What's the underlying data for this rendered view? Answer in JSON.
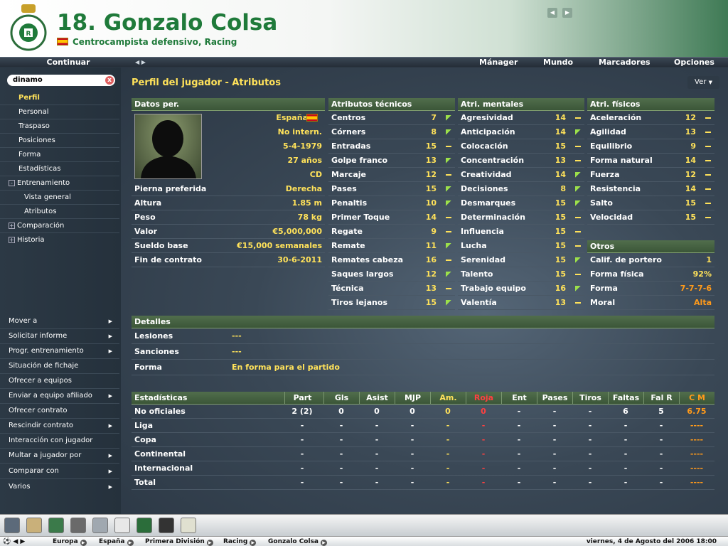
{
  "header": {
    "title": "18. Gonzalo Colsa",
    "subtitle": "Centrocampista defensivo, Racing",
    "club_crest_text": "REAL RACING CLUB SANTANDER"
  },
  "menubar": {
    "continue_label": "Continuar",
    "items": [
      "Mánager",
      "Mundo",
      "Marcadores",
      "Opciones"
    ]
  },
  "sidebar": {
    "search_value": "dinamo",
    "search_clear": "x",
    "items": [
      {
        "label": "Perfil"
      },
      {
        "label": "Personal"
      },
      {
        "label": "Traspaso"
      },
      {
        "label": "Posiciones"
      },
      {
        "label": "Forma"
      },
      {
        "label": "Estadísticas"
      },
      {
        "label": "Entrenamiento"
      },
      {
        "label": "Vista general"
      },
      {
        "label": "Atributos"
      },
      {
        "label": "Comparación"
      },
      {
        "label": "Historia"
      }
    ],
    "actions": [
      "Mover a",
      "Solicitar informe",
      "Progr. entrenamiento",
      "Situación de fichaje",
      "Ofrecer a equipos",
      "Enviar a equipo afiliado",
      "Ofrecer contrato",
      "Rescindir contrato",
      "Interacción con jugador",
      "Multar a jugador por",
      "Comparar con",
      "Varios"
    ]
  },
  "panel": {
    "title": "Perfil del jugador - Atributos",
    "ver_label": "Ver"
  },
  "personal": {
    "header": "Datos per.",
    "nationality": "España",
    "intl": "No intern.",
    "dob": "5-4-1979",
    "age": "27 años",
    "position": "CD",
    "rows": [
      {
        "label": "Pierna preferida",
        "value": "Derecha"
      },
      {
        "label": "Altura",
        "value": "1.85 m"
      },
      {
        "label": "Peso",
        "value": "78 kg"
      },
      {
        "label": "Valor",
        "value": "€5,000,000"
      },
      {
        "label": "Sueldo base",
        "value": "€15,000 semanales"
      },
      {
        "label": "Fin de contrato",
        "value": "30-6-2011"
      }
    ]
  },
  "technical": {
    "header": "Atributos técnicos",
    "rows": [
      {
        "label": "Centros",
        "value": "7",
        "trend": "up"
      },
      {
        "label": "Córners",
        "value": "8",
        "trend": "up"
      },
      {
        "label": "Entradas",
        "value": "15",
        "trend": "eq"
      },
      {
        "label": "Golpe franco",
        "value": "13",
        "trend": "up"
      },
      {
        "label": "Marcaje",
        "value": "12",
        "trend": "eq"
      },
      {
        "label": "Pases",
        "value": "15",
        "trend": "up"
      },
      {
        "label": "Penaltis",
        "value": "10",
        "trend": "up"
      },
      {
        "label": "Primer Toque",
        "value": "14",
        "trend": "eq"
      },
      {
        "label": "Regate",
        "value": "9",
        "trend": "eq"
      },
      {
        "label": "Remate",
        "value": "11",
        "trend": "up"
      },
      {
        "label": "Remates cabeza",
        "value": "16",
        "trend": "eq"
      },
      {
        "label": "Saques largos",
        "value": "12",
        "trend": "up"
      },
      {
        "label": "Técnica",
        "value": "13",
        "trend": "eq"
      },
      {
        "label": "Tiros lejanos",
        "value": "15",
        "trend": "up"
      }
    ]
  },
  "mental": {
    "header": "Atri. mentales",
    "rows": [
      {
        "label": "Agresividad",
        "value": "14",
        "trend": "eq"
      },
      {
        "label": "Anticipación",
        "value": "14",
        "trend": "up"
      },
      {
        "label": "Colocación",
        "value": "15",
        "trend": "eq"
      },
      {
        "label": "Concentración",
        "value": "13",
        "trend": "eq"
      },
      {
        "label": "Creatividad",
        "value": "14",
        "trend": "up"
      },
      {
        "label": "Decisiones",
        "value": "8",
        "trend": "up"
      },
      {
        "label": "Desmarques",
        "value": "15",
        "trend": "up"
      },
      {
        "label": "Determinación",
        "value": "15",
        "trend": "eq"
      },
      {
        "label": "Influencia",
        "value": "15",
        "trend": "eq"
      },
      {
        "label": "Lucha",
        "value": "15",
        "trend": "eq"
      },
      {
        "label": "Serenidad",
        "value": "15",
        "trend": "up"
      },
      {
        "label": "Talento",
        "value": "15",
        "trend": "eq"
      },
      {
        "label": "Trabajo equipo",
        "value": "16",
        "trend": "up"
      },
      {
        "label": "Valentía",
        "value": "13",
        "trend": "eq"
      }
    ]
  },
  "physical": {
    "header": "Atri. físicos",
    "rows": [
      {
        "label": "Aceleración",
        "value": "12",
        "trend": "eq"
      },
      {
        "label": "Agilidad",
        "value": "13",
        "trend": "eq"
      },
      {
        "label": "Equilibrio",
        "value": "9",
        "trend": "eq"
      },
      {
        "label": "Forma natural",
        "value": "14",
        "trend": "eq"
      },
      {
        "label": "Fuerza",
        "value": "12",
        "trend": "eq"
      },
      {
        "label": "Resistencia",
        "value": "14",
        "trend": "eq"
      },
      {
        "label": "Salto",
        "value": "15",
        "trend": "eq"
      },
      {
        "label": "Velocidad",
        "value": "15",
        "trend": "eq"
      }
    ]
  },
  "otros": {
    "header": "Otros",
    "rows": [
      {
        "label": "Calif. de portero",
        "value": "1"
      },
      {
        "label": "Forma física",
        "value": "92%"
      },
      {
        "label": "Forma",
        "value": "7-7-7-6"
      },
      {
        "label": "Moral",
        "value": "Alta"
      }
    ]
  },
  "detalles": {
    "header": "Detalles",
    "rows": [
      {
        "label": "Lesiones",
        "value": "---"
      },
      {
        "label": "Sanciones",
        "value": "---"
      },
      {
        "label": "Forma",
        "value": "En forma para el partido"
      }
    ]
  },
  "stats": {
    "header": "Estadísticas",
    "columns": [
      "Part",
      "Gls",
      "Asist",
      "MJP",
      "Am.",
      "Roja",
      "Ent",
      "Pases",
      "Tiros",
      "Faltas",
      "Fal R",
      "C M"
    ],
    "rows": [
      {
        "label": "No oficiales",
        "cells": [
          "2 (2)",
          "0",
          "0",
          "0",
          "0",
          "0",
          "-",
          "-",
          "-",
          "6",
          "5",
          "6.75"
        ]
      },
      {
        "label": "Liga",
        "cells": [
          "-",
          "-",
          "-",
          "-",
          "-",
          "-",
          "-",
          "-",
          "-",
          "-",
          "-",
          "----"
        ]
      },
      {
        "label": "Copa",
        "cells": [
          "-",
          "-",
          "-",
          "-",
          "-",
          "-",
          "-",
          "-",
          "-",
          "-",
          "-",
          "----"
        ]
      },
      {
        "label": "Continental",
        "cells": [
          "-",
          "-",
          "-",
          "-",
          "-",
          "-",
          "-",
          "-",
          "-",
          "-",
          "-",
          "----"
        ]
      },
      {
        "label": "Internacional",
        "cells": [
          "-",
          "-",
          "-",
          "-",
          "-",
          "-",
          "-",
          "-",
          "-",
          "-",
          "-",
          "----"
        ]
      },
      {
        "label": "Total",
        "cells": [
          "-",
          "-",
          "-",
          "-",
          "-",
          "-",
          "-",
          "-",
          "-",
          "-",
          "-",
          "----"
        ]
      }
    ]
  },
  "statusbar": {
    "crumbs": [
      "Europa",
      "España",
      "Primera División",
      "Racing",
      "Gonzalo Colsa"
    ],
    "datetime": "viernes, 4 de Agosto del 2006 18:00"
  },
  "colors": {
    "accent_yellow": "#ffe25a",
    "header_green": "#1f7a3a",
    "section_green": "#3b5638",
    "trend_up": "#9ce04a",
    "yellow_card": "#ffe25a",
    "red_card": "#ff4040",
    "avg_rating": "#ff9a1a"
  },
  "toolbar": {
    "icons": [
      "home-icon",
      "inbox-icon",
      "squad-icon",
      "tactics-icon",
      "trophy-icon",
      "notes-icon",
      "pitch-icon",
      "scout-icon",
      "clipboard-icon"
    ]
  }
}
